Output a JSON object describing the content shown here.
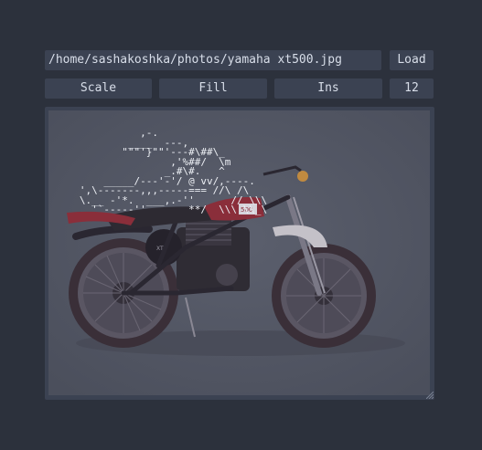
{
  "toolbar": {
    "path_value": "/home/sashakoshka/photos/yamaha xt500.jpg",
    "load_label": "Load",
    "scale_label": "Scale",
    "fill_label": "Fill",
    "ins_label": "Ins",
    "size_value": "12"
  },
  "viewer": {
    "image_subject": "Yamaha XT500 motorcycle",
    "ascii_overlay": "             ,-.\n           ____  ---,\n          \"\"\"'}\"\"'---#\\##\\_\n                  ,'%##/  \\m\n                 _.#\\#.   ^\n       _____/---'-'/ @ vv/,----.\n   ',\\-------,,,-----=== //\\ /\\\n   \\.__ -'*.  ___,.-''      // \\\\\\\n     '`-----''       **/  \\\\\\ \\\\_\\"
  },
  "colors": {
    "background": "#2c313c",
    "control": "#3b4252",
    "text": "#d8dee9"
  }
}
